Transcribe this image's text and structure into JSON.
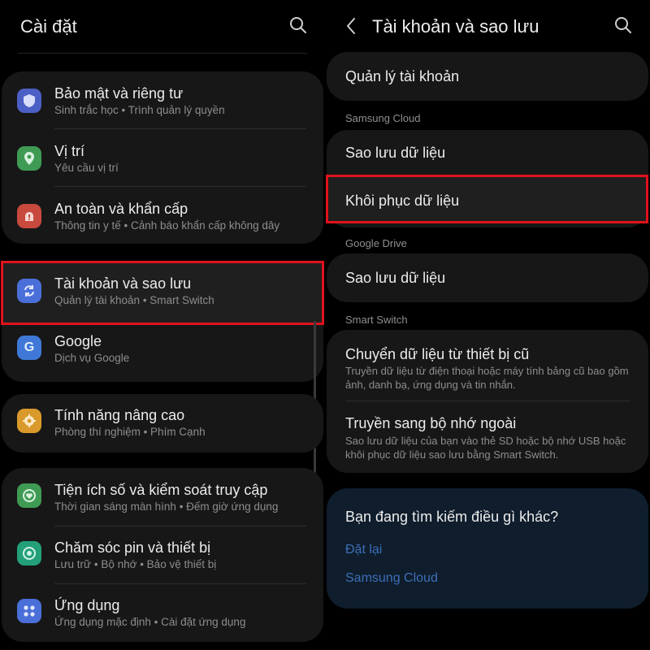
{
  "left": {
    "title": "Cài đặt",
    "items": [
      {
        "label": "Bảo mật và riêng tư",
        "sub": "Sinh trắc học  •  Trình quản lý quyền",
        "color": "#4b5fc4"
      },
      {
        "label": "Vị trí",
        "sub": "Yêu cầu vị trí",
        "color": "#3f9b54"
      },
      {
        "label": "An toàn và khẩn cấp",
        "sub": "Thông tin y tế  •  Cảnh báo khẩn cấp không dây",
        "color": "#c84a3e"
      },
      {
        "label": "Tài khoản và sao lưu",
        "sub": "Quản lý tài khoản  •  Smart Switch",
        "color": "#4b6fd8"
      },
      {
        "label": "Google",
        "sub": "Dịch vụ Google",
        "color": "#3f78d6"
      },
      {
        "label": "Tính năng nâng cao",
        "sub": "Phòng thí nghiệm  •  Phím Cạnh",
        "color": "#d99a2b"
      },
      {
        "label": "Tiện ích số và kiểm soát truy cập",
        "sub": "Thời gian sáng màn hình  •  Đếm giờ ứng dụng",
        "color": "#3f9b54"
      },
      {
        "label": "Chăm sóc pin và thiết bị",
        "sub": "Lưu trữ  •  Bộ nhớ  •  Bảo vệ thiết bị",
        "color": "#23a07a"
      },
      {
        "label": "Ứng dụng",
        "sub": "Ứng dụng mặc định  •  Cài đặt ứng dụng",
        "color": "#4b6fd8"
      }
    ]
  },
  "right": {
    "title": "Tài khoản và sao lưu",
    "manage_accounts": "Quản lý tài khoản",
    "samsung_cloud": {
      "section": "Samsung Cloud",
      "backup": "Sao lưu dữ liệu",
      "restore": "Khôi phục dữ liệu"
    },
    "google_drive": {
      "section": "Google Drive",
      "backup": "Sao lưu dữ liệu"
    },
    "smart_switch": {
      "section": "Smart Switch",
      "transfer_title": "Chuyển dữ liệu từ thiết bị cũ",
      "transfer_desc": "Truyền dữ liệu từ điện thoại hoặc máy tính bảng cũ bao gồm ảnh, danh bạ, ứng dụng và tin nhắn.",
      "external_title": "Truyền sang bộ nhớ ngoài",
      "external_desc": "Sao lưu dữ liệu của bạn vào thẻ SD hoặc bộ nhớ USB hoặc khôi phục dữ liệu sao lưu bằng Smart Switch."
    },
    "suggestions": {
      "title": "Bạn đang tìm kiếm điều gì khác?",
      "links": [
        "Đặt lại",
        "Samsung Cloud"
      ]
    }
  },
  "colors": {
    "highlight": "#e0121b",
    "card": "#171717",
    "suggest_card": "#0f1d2c",
    "link": "#3d6fb8"
  },
  "icons": {
    "search": "search-icon",
    "back": "back-arrow-icon"
  }
}
